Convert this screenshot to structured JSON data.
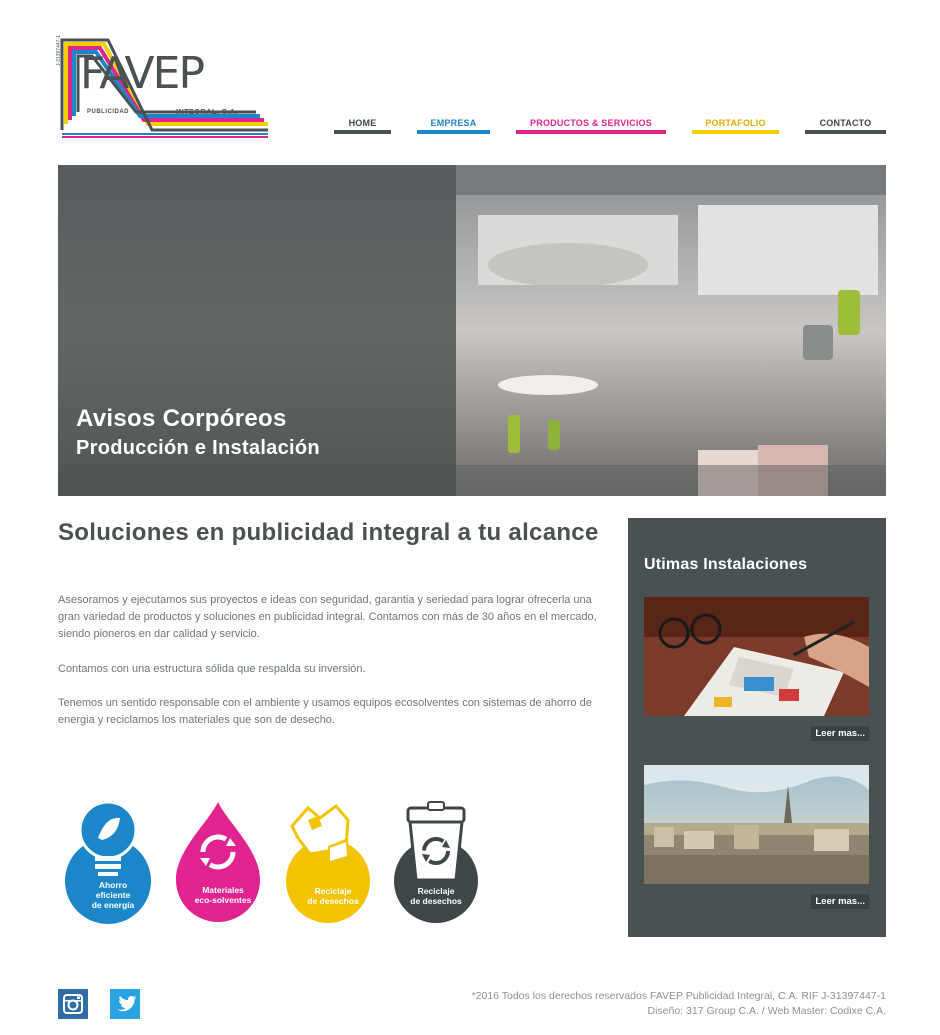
{
  "logo": {
    "brand": "FAVEP",
    "sub_left": "PUBLICIDAD",
    "sub_right": "INTEGRAL, C.A.",
    "rif_vertical": "J-31397447-1",
    "stripe_colors": [
      "#4a5152",
      "#1b86c8",
      "#e0238e",
      "#f3d100"
    ]
  },
  "nav": {
    "items": [
      {
        "label": "HOME",
        "color": "#4a5152"
      },
      {
        "label": "EMPRESA",
        "color": "#1b86c8"
      },
      {
        "label": "PRODUCTOS & SERVICIOS",
        "color": "#e0238e"
      },
      {
        "label": "PORTAFOLIO",
        "color": "#f3d100"
      },
      {
        "label": "CONTACTO",
        "color": "#4a5152"
      }
    ]
  },
  "hero": {
    "title": "Avisos Corpóreos",
    "subtitle": "Producción e Instalación"
  },
  "main": {
    "headline": "Soluciones en publicidad integral a tu alcance",
    "paragraphs": [
      "Asesoramos y ejecutamos sus proyectos e ideas con seguridad, garantia y seriedad para lograr ofrecerla una gran variedad de productos y soluciones en publicidad integral. Contamos con más de 30 años en el mercado, siendo pioneros en dar calidad y servicio.",
      "Contamos con una estructura sólida que respalda su inversión.",
      "Tenemos un sentido responsable con el ambiente y usamos equipos ecosolventes con sistemas de ahorro de energia y reciclamos los materiales que son de desecho."
    ],
    "badges": [
      {
        "line1": "Ahorro",
        "line2": "eficiente",
        "line3": "de energía",
        "color": "#1b86c8",
        "icon": "lightbulb-icon"
      },
      {
        "line1": "Materiales",
        "line2": "eco-solventes",
        "color": "#e0238e",
        "icon": "drop-recycle-icon"
      },
      {
        "line1": "Reciclaje",
        "line2": "de desechos",
        "color": "#f3c300",
        "icon": "recycle-bag-icon"
      },
      {
        "line1": "Reciclaje",
        "line2": "de desechos",
        "color": "#3f4647",
        "icon": "recycle-bin-icon"
      }
    ]
  },
  "sidebar": {
    "title": "Utimas Instalaciones",
    "items": [
      {
        "read_more": "Leer mas..."
      },
      {
        "read_more": "Leer mas..."
      }
    ]
  },
  "footer": {
    "line1": "*2016 Todos los derechos reservados FAVEP Publicidad Integral, C.A. RIF J-31397447-1",
    "line2": "Diseño: 317 Group C.A. / Web Master: Codixe C.A.",
    "social": [
      "instagram-icon",
      "twitter-icon"
    ]
  }
}
